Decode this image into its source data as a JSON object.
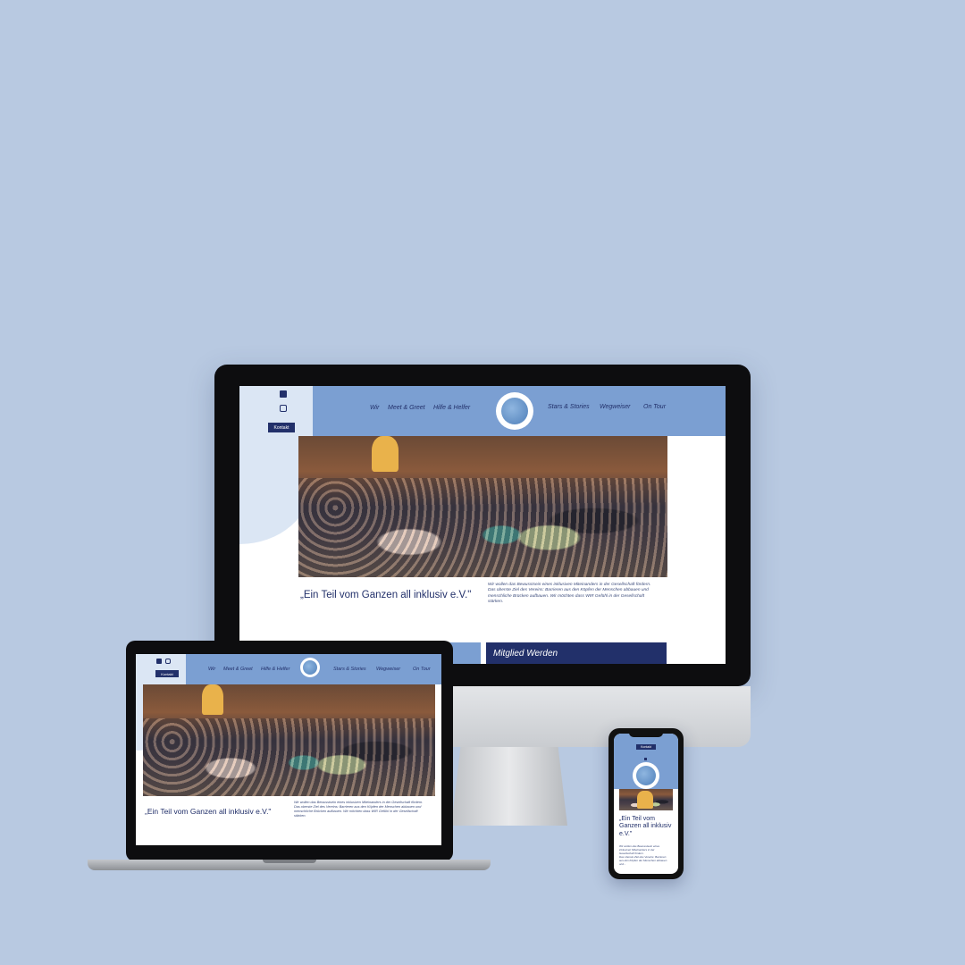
{
  "site": {
    "nav_left": [
      "Wir",
      "Meet & Greet",
      "Hilfe & Helfer"
    ],
    "nav_right": [
      "Stars & Stories",
      "Wegweiser",
      "On Tour"
    ],
    "kontakt_label": "Kontakt",
    "title": "„Ein Teil vom Ganzen all inklusiv e.V.\"",
    "title_mobile": "„Ein Teil vom Ganzen all inklusiv e.V.\"",
    "intro_lines": [
      "Wir wollen das Bewusstsein eines inklusiven Miteinanders in der Gesellschaft fördern.",
      "Das oberste Ziel des Vereins: Barrieren aus den Köpfen der Menschen abbauen und",
      "menschliche Brücken aufbauen. Wir möchten dass WIR Gefühl in der Gesellschaft",
      "stärken."
    ],
    "mobile_intro_lines": [
      "Wir wollen das Bewusstsein eines",
      "inklusiven Miteinanders in der",
      "Gesellschaft fördern.",
      "Das oberste Ziel des Vereins: Barrieren",
      "aus den Köpfen der Menschen abbauen",
      "und..."
    ],
    "card_label": "Mitglied Werden"
  },
  "icons": [
    "facebook-icon",
    "instagram-icon",
    "globe-logo-icon"
  ],
  "colors": {
    "background": "#b8c9e1",
    "header": "#7b9fd2",
    "accent_navy": "#22306a",
    "blob": "#dbe6f4"
  }
}
